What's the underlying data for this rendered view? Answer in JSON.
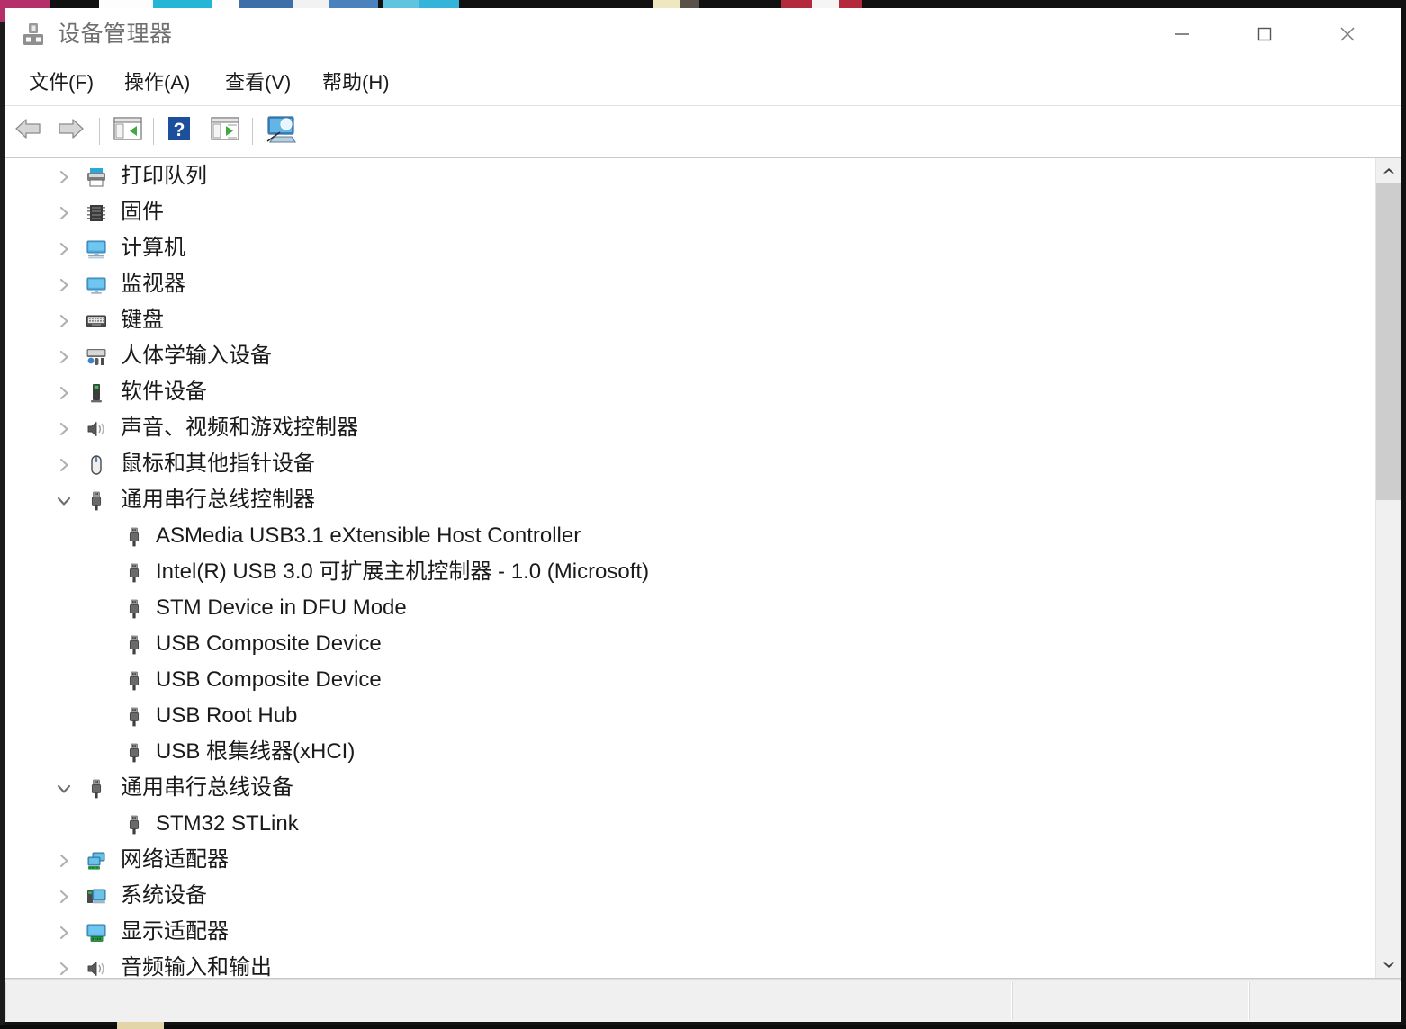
{
  "window": {
    "title": "设备管理器",
    "title_icon": "device-manager-icon",
    "controls": {
      "minimize": "—",
      "maximize": "▢",
      "close": "✕"
    }
  },
  "menubar": {
    "items": [
      {
        "label": "文件(F)",
        "name": "menu-file"
      },
      {
        "label": "操作(A)",
        "name": "menu-action"
      },
      {
        "label": "查看(V)",
        "name": "menu-view"
      },
      {
        "label": "帮助(H)",
        "name": "menu-help"
      }
    ]
  },
  "toolbar": {
    "buttons": [
      {
        "icon": "back-arrow-icon",
        "label": "后退"
      },
      {
        "icon": "forward-arrow-icon",
        "label": "前进"
      },
      {
        "icon": "show-hide-console-tree-icon",
        "label": "显示/隐藏控制台树"
      },
      {
        "icon": "help-question-icon",
        "label": "帮助"
      },
      {
        "icon": "properties-icon",
        "label": "属性"
      },
      {
        "icon": "scan-hardware-changes-icon",
        "label": "扫描检测硬件改动"
      }
    ]
  },
  "tree": {
    "rows": [
      {
        "label": "打印队列",
        "level": 0,
        "expanded": false,
        "icon": "printer-icon"
      },
      {
        "label": "固件",
        "level": 0,
        "expanded": false,
        "icon": "firmware-chip-icon"
      },
      {
        "label": "计算机",
        "level": 0,
        "expanded": false,
        "icon": "computer-monitor-icon"
      },
      {
        "label": "监视器",
        "level": 0,
        "expanded": false,
        "icon": "monitor-icon"
      },
      {
        "label": "键盘",
        "level": 0,
        "expanded": false,
        "icon": "keyboard-icon"
      },
      {
        "label": "人体学输入设备",
        "level": 0,
        "expanded": false,
        "icon": "hid-device-icon"
      },
      {
        "label": "软件设备",
        "level": 0,
        "expanded": false,
        "icon": "software-device-icon"
      },
      {
        "label": "声音、视频和游戏控制器",
        "level": 0,
        "expanded": false,
        "icon": "speaker-icon"
      },
      {
        "label": "鼠标和其他指针设备",
        "level": 0,
        "expanded": false,
        "icon": "mouse-icon"
      },
      {
        "label": "通用串行总线控制器",
        "level": 0,
        "expanded": true,
        "icon": "usb-icon"
      },
      {
        "label": "ASMedia USB3.1 eXtensible Host Controller",
        "level": 1,
        "icon": "usb-icon"
      },
      {
        "label": "Intel(R) USB 3.0 可扩展主机控制器 - 1.0 (Microsoft)",
        "level": 1,
        "icon": "usb-icon"
      },
      {
        "label": "STM Device in DFU Mode",
        "level": 1,
        "icon": "usb-icon"
      },
      {
        "label": "USB Composite Device",
        "level": 1,
        "icon": "usb-icon"
      },
      {
        "label": "USB Composite Device",
        "level": 1,
        "icon": "usb-icon"
      },
      {
        "label": "USB Root Hub",
        "level": 1,
        "icon": "usb-icon"
      },
      {
        "label": "USB 根集线器(xHCI)",
        "level": 1,
        "icon": "usb-icon"
      },
      {
        "label": "通用串行总线设备",
        "level": 0,
        "expanded": true,
        "icon": "usb-icon"
      },
      {
        "label": "STM32 STLink",
        "level": 1,
        "icon": "usb-icon"
      },
      {
        "label": "网络适配器",
        "level": 0,
        "expanded": false,
        "icon": "network-adapter-icon"
      },
      {
        "label": "系统设备",
        "level": 0,
        "expanded": false,
        "icon": "system-device-icon"
      },
      {
        "label": "显示适配器",
        "level": 0,
        "expanded": false,
        "icon": "display-adapter-icon"
      },
      {
        "label": "音频输入和输出",
        "level": 0,
        "expanded": false,
        "icon": "speaker-icon"
      }
    ]
  },
  "scrollbar": {
    "up_arrow": "scroll-up-arrow-icon",
    "down_arrow": "scroll-down-arrow-icon",
    "thumb": "scroll-thumb"
  },
  "statusbar": {
    "cells": [
      "",
      "",
      ""
    ]
  },
  "colors": {
    "window_bg": "#ffffff",
    "title_text": "#6f6f6f",
    "tree_text": "#1a1a1a",
    "chevron": "#aaaaaa",
    "statusbar_bg": "#f0f0f0",
    "scroll_thumb": "#cdcdcd",
    "accent_blue": "#1c6fb8"
  }
}
